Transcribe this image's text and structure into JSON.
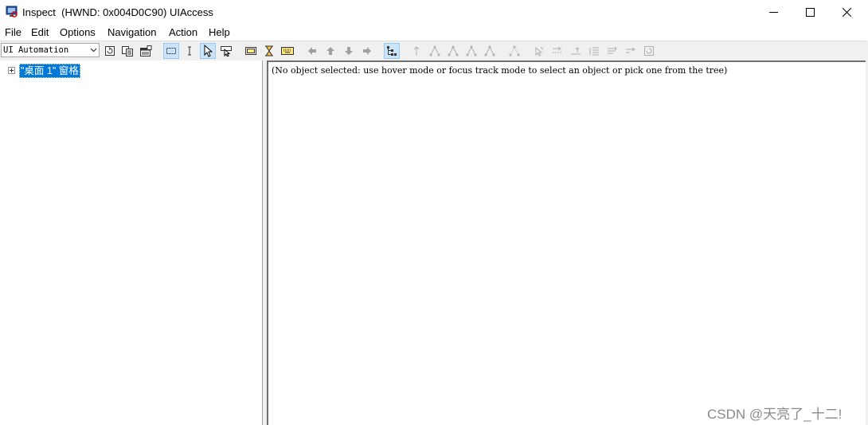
{
  "window": {
    "title": "Inspect  (HWND: 0x004D0C90) UIAccess",
    "controls": {
      "minimize": "minimize-icon",
      "maximize": "maximize-icon",
      "close": "close-icon"
    }
  },
  "menu": [
    "File",
    "Edit",
    "Options",
    "Navigation",
    "Action",
    "Help"
  ],
  "toolbar": {
    "mode_select_value": "UI Automation",
    "buttons": [
      "refresh-icon",
      "copy-icon",
      "properties-icon",
      "highlight-rectangle-icon",
      "caret-icon",
      "hover-mode-icon",
      "focus-tracking-icon",
      "show-rectangle-icon",
      "hourglass-icon",
      "keyboard-icon",
      "nav-back-icon",
      "nav-up-icon",
      "nav-down-icon",
      "nav-forward-icon",
      "tree-view-icon"
    ]
  },
  "tree": {
    "root_label": "\"桌面 1\" 窗格"
  },
  "details": {
    "text": "(No object selected: use hover mode or focus track mode to select an object or pick one from the tree)"
  },
  "watermark": "CSDN @天亮了_十二!",
  "colors": {
    "selection": "#0078d7",
    "toolbar_bg": "#f0f0f0",
    "active_button": "#cce4f7"
  }
}
